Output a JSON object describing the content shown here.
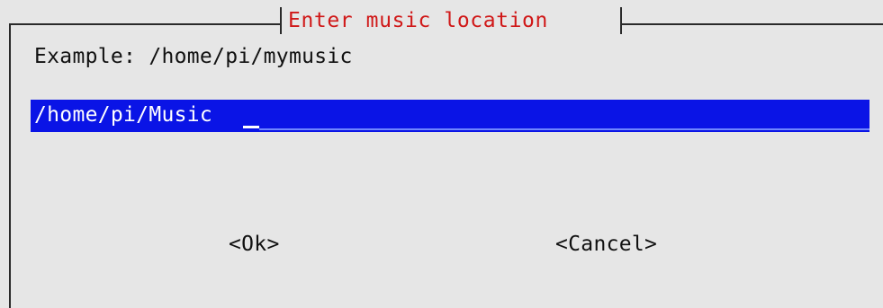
{
  "dialog": {
    "title": "Enter music location",
    "example": "Example: /home/pi/mymusic"
  },
  "input": {
    "value": "/home/pi/Music"
  },
  "buttons": {
    "ok_label": "<Ok>",
    "cancel_label": "<Cancel>"
  },
  "colors": {
    "background": "#e6e6e6",
    "title": "#d01818",
    "input_bg": "#0a14e6",
    "input_text": "#ffffff",
    "frame": "#2a2a2a"
  }
}
